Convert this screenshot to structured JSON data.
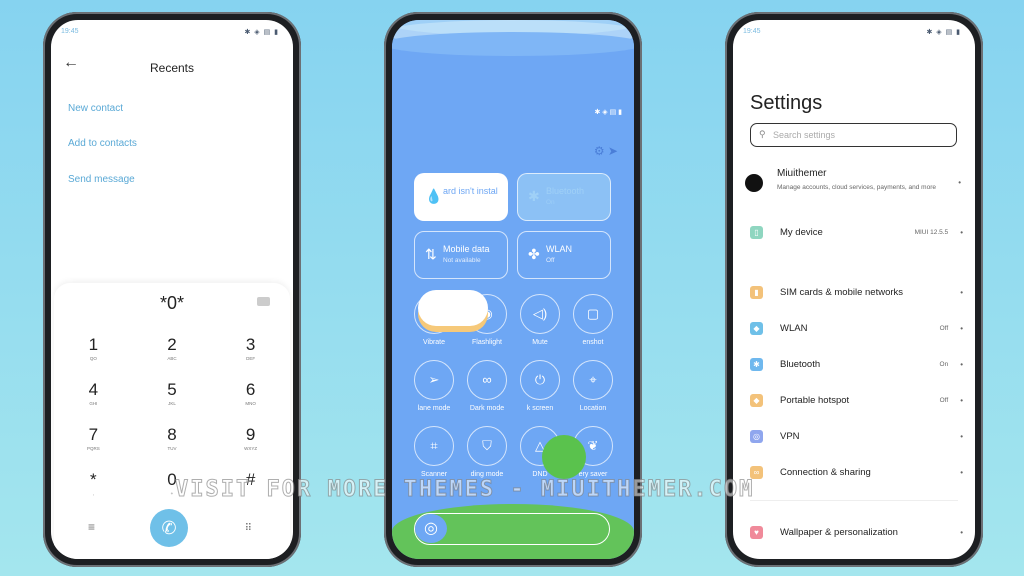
{
  "status": {
    "time": "19:45",
    "icons": "✱ ◈ ▤ ▮"
  },
  "dialer": {
    "title": "Recents",
    "back_icon": "arrow-left-icon",
    "links": [
      "New contact",
      "Add to contacts",
      "Send message"
    ],
    "dialed": "*0*",
    "keys": [
      {
        "d": "1",
        "l": "QO"
      },
      {
        "d": "2",
        "l": "ABC"
      },
      {
        "d": "3",
        "l": "DEF"
      },
      {
        "d": "4",
        "l": "GHI"
      },
      {
        "d": "5",
        "l": "JKL"
      },
      {
        "d": "6",
        "l": "MNO"
      },
      {
        "d": "7",
        "l": "PQRS"
      },
      {
        "d": "8",
        "l": "TUV"
      },
      {
        "d": "9",
        "l": "WXYZ"
      },
      {
        "d": "*",
        "l": ","
      },
      {
        "d": "0",
        "l": "+"
      },
      {
        "d": "#",
        "l": ""
      }
    ],
    "call_color": "#6fc0e8"
  },
  "control": {
    "bg": "#6ea7f4",
    "tiles": [
      {
        "label": "ard isn't instal",
        "sub": ""
      },
      {
        "label": "Bluetooth",
        "sub": "On"
      },
      {
        "label": "Mobile data",
        "sub": "Not available"
      },
      {
        "label": "WLAN",
        "sub": "Off"
      }
    ],
    "toggles": [
      "Vibrate",
      "Flashlight",
      "Mute",
      "enshot",
      "lane mode",
      "Dark mode",
      "k screen",
      "Location",
      "Scanner",
      "ding mode",
      "DND",
      "ery saver"
    ]
  },
  "settings": {
    "title": "Settings",
    "search_placeholder": "Search settings",
    "account": {
      "name": "Miuithemer",
      "desc": "Manage accounts, cloud services, payments, and more"
    },
    "device": {
      "label": "My device",
      "value": "MIUI 12.5.5"
    },
    "items": [
      {
        "label": "SIM cards & mobile networks",
        "value": "",
        "color": "#f3c27a"
      },
      {
        "label": "WLAN",
        "value": "Off",
        "color": "#6fc0e8"
      },
      {
        "label": "Bluetooth",
        "value": "On",
        "color": "#6fb8ee"
      },
      {
        "label": "Portable hotspot",
        "value": "Off",
        "color": "#f3c27a"
      },
      {
        "label": "VPN",
        "value": "",
        "color": "#8fa6ee"
      },
      {
        "label": "Connection & sharing",
        "value": "",
        "color": "#f3c27a"
      },
      {
        "label": "Wallpaper & personalization",
        "value": "",
        "color": "#f08a9a"
      }
    ]
  },
  "watermark": "VISIT FOR MORE THEMES - MIUITHEMER.COM"
}
